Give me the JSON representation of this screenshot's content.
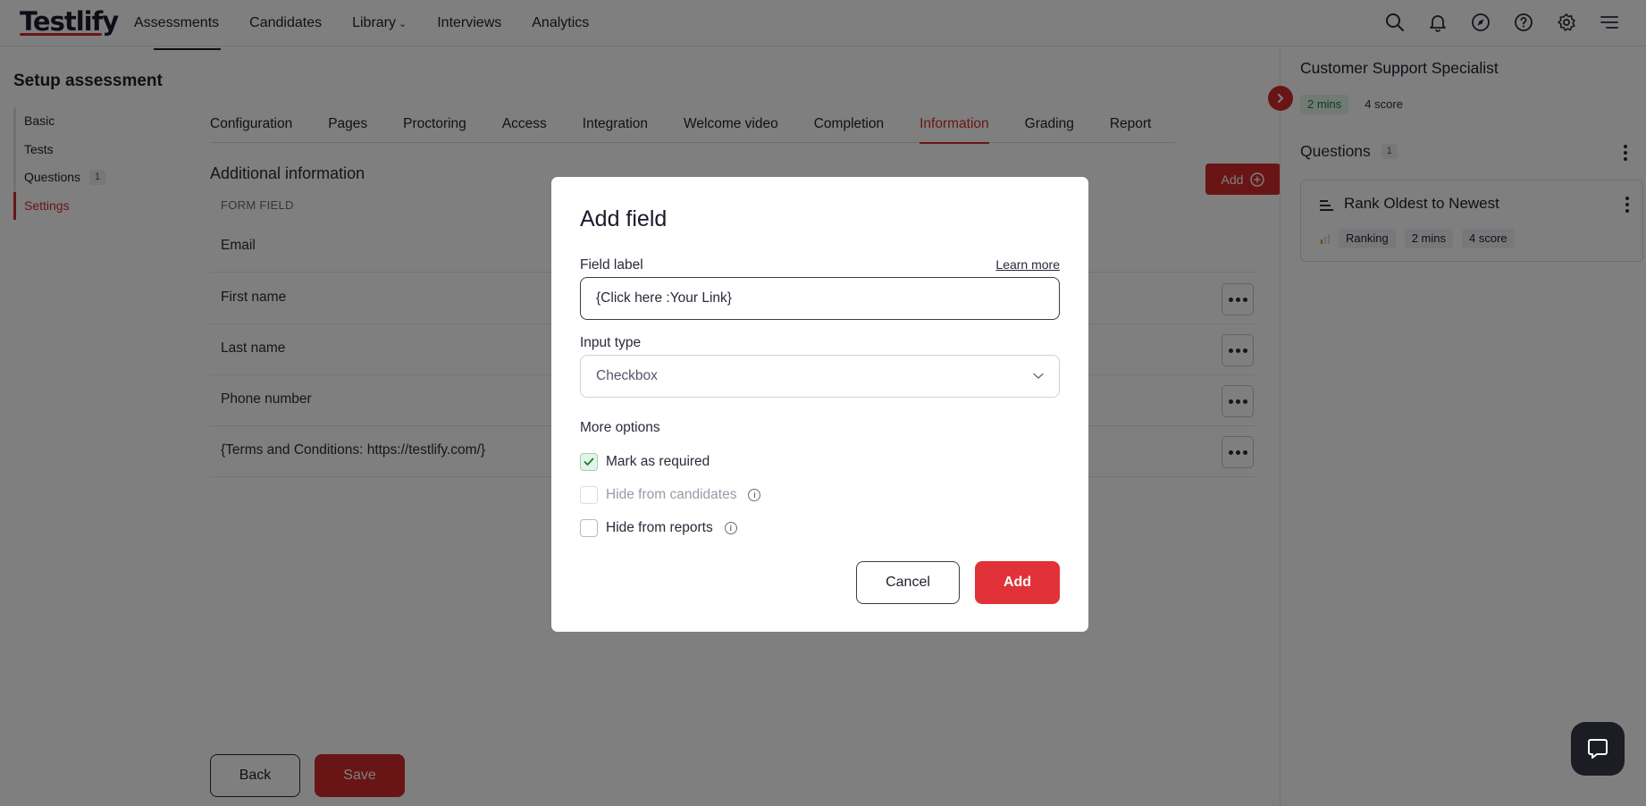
{
  "nav": {
    "logo": "Testlify",
    "links": [
      {
        "label": "Assessments"
      },
      {
        "label": "Candidates"
      },
      {
        "label": "Library"
      },
      {
        "label": "Interviews"
      },
      {
        "label": "Analytics"
      }
    ],
    "icons": [
      "search-icon",
      "bell-icon",
      "compass-icon",
      "help-icon",
      "gear-icon",
      "menu-icon"
    ]
  },
  "sidebar": {
    "title": "Setup assessment",
    "items": [
      {
        "label": "Basic"
      },
      {
        "label": "Tests"
      },
      {
        "label": "Questions",
        "count": "1"
      },
      {
        "label": "Settings"
      }
    ]
  },
  "tabs": [
    {
      "label": "Configuration"
    },
    {
      "label": "Pages"
    },
    {
      "label": "Proctoring"
    },
    {
      "label": "Access"
    },
    {
      "label": "Integration"
    },
    {
      "label": "Welcome video"
    },
    {
      "label": "Completion"
    },
    {
      "label": "Information"
    },
    {
      "label": "Grading"
    },
    {
      "label": "Report"
    }
  ],
  "info_section": {
    "title": "Additional information",
    "add_label": "Add",
    "column_header": "FORM FIELD",
    "fields": [
      {
        "label": "Email"
      },
      {
        "label": "First name"
      },
      {
        "label": "Last name"
      },
      {
        "label": "Phone number"
      },
      {
        "label": "{Terms and Conditions: https://testlify.com/}"
      }
    ]
  },
  "footer": {
    "back_label": "Back",
    "save_label": "Save"
  },
  "right_panel": {
    "title": "Customer Support Specialist",
    "duration": "2 mins",
    "score": "4 score",
    "questions_label": "Questions",
    "questions_count": "1",
    "question": {
      "title": "Rank Oldest to Newest",
      "type": "Ranking",
      "duration": "2 mins",
      "score": "4 score"
    }
  },
  "modal": {
    "title": "Add field",
    "field_label_caption": "Field label",
    "learn_more": "Learn more",
    "field_label_value": "{Click here :Your Link}",
    "input_type_caption": "Input type",
    "input_type_value": "Checkbox",
    "more_options_caption": "More options",
    "options": [
      {
        "label": "Mark as required",
        "checked": true
      },
      {
        "label": "Hide from candidates",
        "checked": false
      },
      {
        "label": "Hide from reports",
        "checked": false
      }
    ],
    "cancel_label": "Cancel",
    "add_label": "Add"
  },
  "colors": {
    "accent": "#d52b2b",
    "overlay": "rgba(0,0,0,0.5)"
  }
}
